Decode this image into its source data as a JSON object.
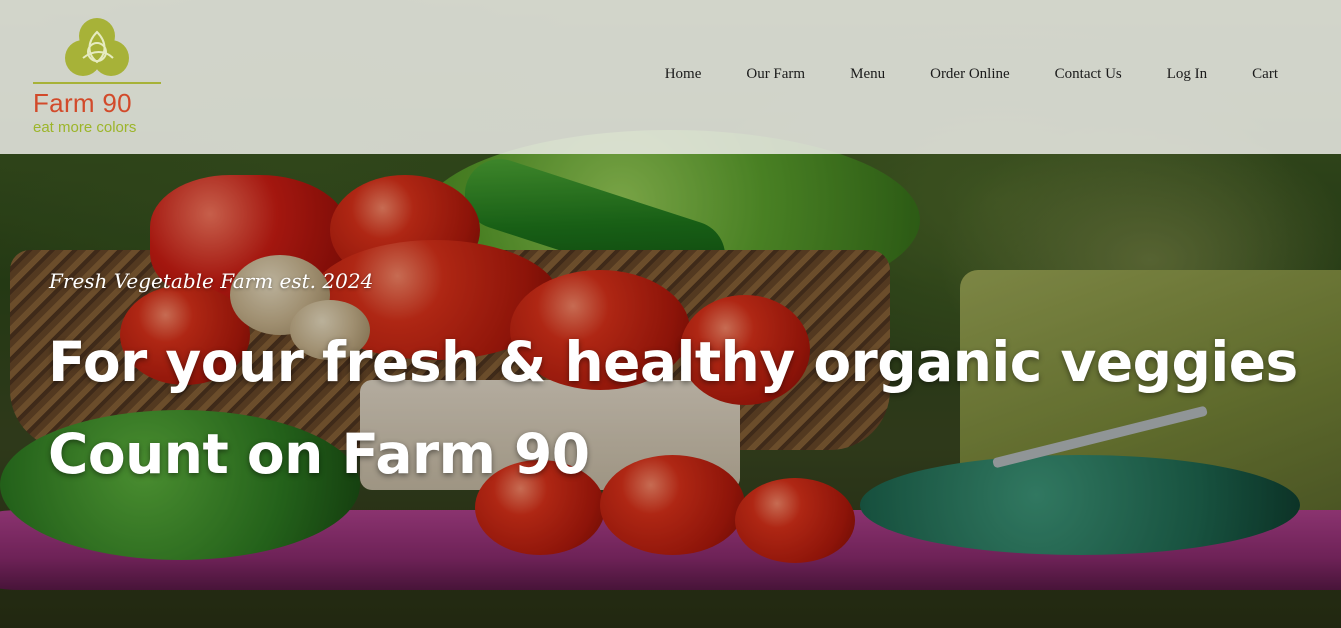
{
  "brand": {
    "name": "Farm 90",
    "tagline": "eat more colors",
    "colors": {
      "name": "#d24a2a",
      "tagline": "#9cb52a",
      "mark": "#a7b238"
    }
  },
  "nav": {
    "items": [
      {
        "label": "Home"
      },
      {
        "label": "Our Farm"
      },
      {
        "label": "Menu"
      },
      {
        "label": "Order Online"
      },
      {
        "label": "Contact Us"
      },
      {
        "label": "Log In"
      },
      {
        "label": "Cart"
      }
    ]
  },
  "hero": {
    "subtitle": "Fresh Vegetable Farm est. 2024",
    "headline_line1": "For your fresh & healthy organic veggies",
    "headline_line2": "Count on Farm 90"
  }
}
